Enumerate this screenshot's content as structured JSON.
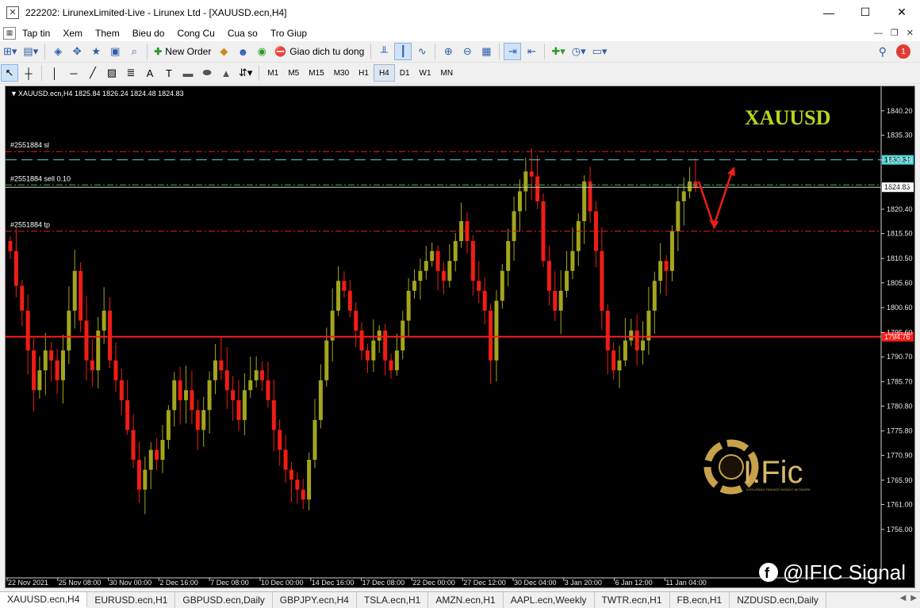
{
  "window": {
    "title": "222202: LirunexLimited-Live - Lirunex Ltd - [XAUUSD.ecn,H4]",
    "minimize": "—",
    "maximize": "☐",
    "close": "✕"
  },
  "menu": [
    "Tap tin",
    "Xem",
    "Them",
    "Bieu do",
    "Cong Cu",
    "Cua so",
    "Tro Giup"
  ],
  "toolbar": {
    "new_order": "New Order",
    "auto_trading": "Giao dich tu dong",
    "notification_count": "1"
  },
  "timeframes": [
    "M1",
    "M5",
    "M15",
    "M30",
    "H1",
    "H4",
    "D1",
    "W1",
    "MN"
  ],
  "active_timeframe": "H4",
  "chart": {
    "info": "XAUUSD.ecn,H4  1825.84 1826.24 1824.48 1824.83",
    "symbol_watermark": "XAUUSD",
    "logo_text": "I.Fic",
    "logo_tagline": "EXPLORING FINANCE INSIGHT NETWORK",
    "social_handle": "@IFIC Signal",
    "order_lines": [
      {
        "label": "#2551884 sl",
        "price": 1832.0,
        "color": "#e0201c"
      },
      {
        "label": "#2551884 sell 0.10",
        "price": 1825.3,
        "color": "#2fbf3f"
      },
      {
        "label": "#2551884 tp",
        "price": 1816.0,
        "color": "#e0201c"
      }
    ],
    "ask_line": {
      "price": 1830.34,
      "label": "1830.34",
      "color": "#4fd6d6"
    },
    "bid_line": {
      "price": 1824.83,
      "label": "1824.83"
    },
    "support_line": {
      "price": 1794.76,
      "label": "1794.76",
      "color": "#ff1a1a"
    }
  },
  "chart_data": {
    "type": "candlestick",
    "title": "XAUUSD.ecn,H4",
    "ylim": [
      1751.35,
      1843.2
    ],
    "y_ticks": [
      1840.2,
      1835.3,
      1830.3,
      1825.3,
      1820.4,
      1815.5,
      1810.5,
      1805.6,
      1800.6,
      1795.6,
      1790.7,
      1785.7,
      1780.8,
      1775.8,
      1770.9,
      1765.9,
      1761.0,
      1756.0
    ],
    "x_ticks": [
      "22 Nov 2021",
      "25 Nov 08:00",
      "30 Nov 00:00",
      "2 Dec 16:00",
      "7 Dec 08:00",
      "10 Dec 00:00",
      "14 Dec 16:00",
      "17 Dec 08:00",
      "22 Dec 00:00",
      "27 Dec 12:00",
      "30 Dec 04:00",
      "3 Jan 20:00",
      "6 Jan 12:00",
      "11 Jan 04:00"
    ],
    "closes": [
      1812,
      1805,
      1800,
      1792,
      1784,
      1788,
      1792,
      1790,
      1786,
      1792,
      1800,
      1808,
      1798,
      1790,
      1788,
      1796,
      1800,
      1790,
      1786,
      1782,
      1776,
      1770,
      1764,
      1768,
      1772,
      1770,
      1774,
      1780,
      1786,
      1782,
      1784,
      1780,
      1776,
      1780,
      1786,
      1790,
      1788,
      1784,
      1782,
      1778,
      1784,
      1786,
      1788,
      1786,
      1782,
      1776,
      1772,
      1768,
      1766,
      1764,
      1762,
      1770,
      1778,
      1786,
      1794,
      1800,
      1806,
      1804,
      1800,
      1796,
      1792,
      1790,
      1794,
      1796,
      1790,
      1788,
      1792,
      1798,
      1804,
      1806,
      1808,
      1810,
      1812,
      1808,
      1806,
      1810,
      1814,
      1818,
      1814,
      1806,
      1804,
      1800,
      1790,
      1802,
      1808,
      1814,
      1820,
      1824,
      1828,
      1827,
      1822,
      1810,
      1804,
      1800,
      1804,
      1808,
      1812,
      1818,
      1826,
      1820,
      1812,
      1800,
      1792,
      1788,
      1790,
      1794,
      1796,
      1792,
      1794,
      1800,
      1806,
      1810,
      1808,
      1816,
      1822,
      1824,
      1826,
      1824.83
    ],
    "price_annotations": [
      "1830.34",
      "1824.83",
      "1794.76"
    ],
    "arrow": "projected move down to 1817 then up to 1828"
  },
  "tabs": [
    "XAUUSD.ecn,H4",
    "EURUSD.ecn,H1",
    "GBPUSD.ecn,Daily",
    "GBPJPY.ecn,H4",
    "TSLA.ecn,H1",
    "AMZN.ecn,H1",
    "AAPL.ecn,Weekly",
    "TWTR.ecn,H1",
    "FB.ecn,H1",
    "NZDUSD.ecn,Daily"
  ],
  "active_tab": "XAUUSD.ecn,H4"
}
